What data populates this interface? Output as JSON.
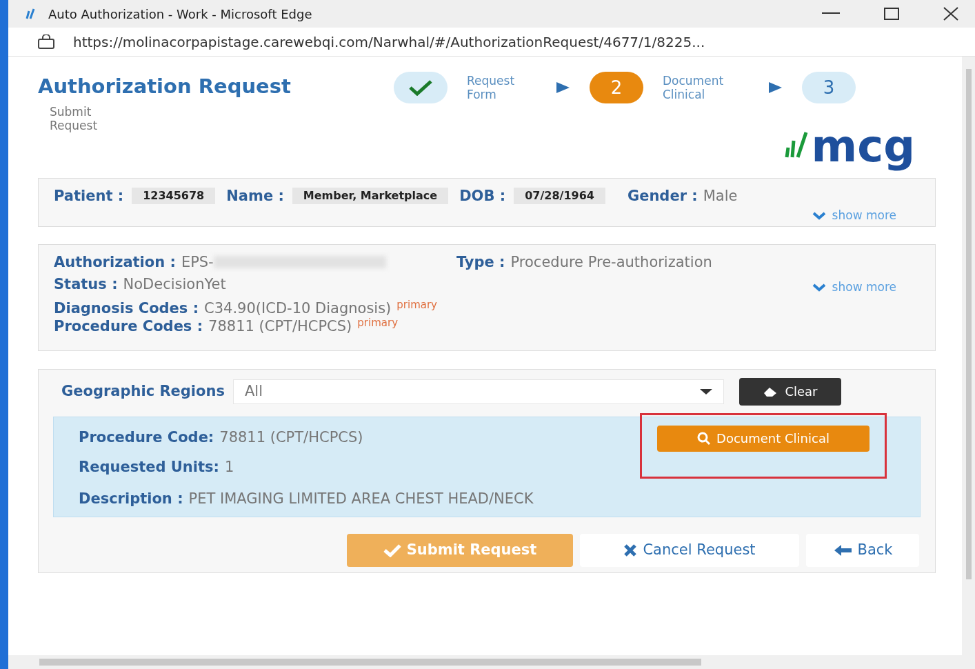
{
  "window": {
    "title": "Auto Authorization - Work - Microsoft Edge"
  },
  "address_bar": {
    "url": "https://molinacorpapistage.carewebqi.com/Narwhal/#/AuthorizationRequest/4677/1/8225..."
  },
  "header": {
    "title": "Authorization Request",
    "subtitle": "Submit Request",
    "logo": "mcg",
    "steps": [
      {
        "kind": "done",
        "label": "Request Form"
      },
      {
        "kind": "current",
        "number": "2",
        "label": "Document Clinical"
      },
      {
        "kind": "pending",
        "number": "3"
      }
    ]
  },
  "patient": {
    "fields": [
      {
        "label": "Patient :",
        "value": "12345678"
      },
      {
        "label": "Name :",
        "value": "Member, Marketplace"
      },
      {
        "label": "DOB :",
        "value": "07/28/1964"
      }
    ],
    "gender": {
      "label": "Gender :",
      "value": "Male"
    },
    "show_more": "show more"
  },
  "authorization": {
    "id": {
      "label": "Authorization :",
      "value": "EPS-"
    },
    "type": {
      "label": "Type :",
      "value": "Procedure Pre-authorization"
    },
    "status": {
      "label": "Status :",
      "value": "NoDecisionYet"
    },
    "show_more": "show more",
    "codes": [
      {
        "label": "Diagnosis Codes :",
        "value": "C34.90(ICD-10 Diagnosis)",
        "tag": "primary"
      },
      {
        "label": "Procedure Codes :",
        "value": "78811 (CPT/HCPCS)",
        "tag": "primary"
      }
    ]
  },
  "regions": {
    "label": "Geographic Regions",
    "value": "All",
    "clear": "Clear"
  },
  "procedure": {
    "code": {
      "label": "Procedure Code:",
      "value": "78811 (CPT/HCPCS)"
    },
    "units": {
      "label": "Requested Units:",
      "value": "1"
    },
    "description": {
      "label": "Description :",
      "value": "PET IMAGING LIMITED AREA CHEST HEAD/NECK"
    },
    "action": "Document Clinical"
  },
  "buttons": [
    {
      "kind": "submit",
      "label": "Submit Request"
    },
    {
      "kind": "cancel",
      "label": "Cancel Request"
    },
    {
      "kind": "back",
      "label": "Back"
    }
  ]
}
